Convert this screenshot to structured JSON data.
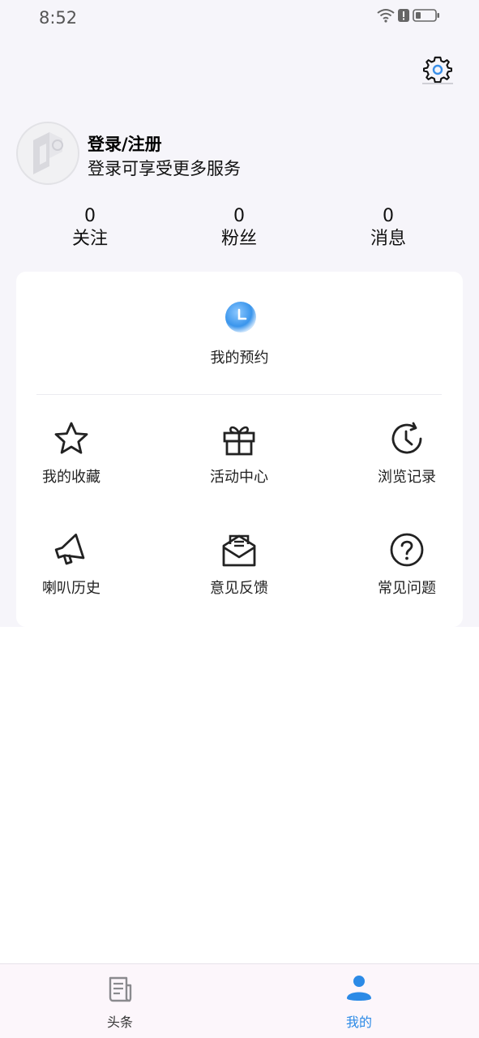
{
  "status_bar": {
    "time": "8:52"
  },
  "profile": {
    "title": "登录/注册",
    "subtitle": "登录可享受更多服务"
  },
  "stats": [
    {
      "value": "0",
      "label": "关注"
    },
    {
      "value": "0",
      "label": "粉丝"
    },
    {
      "value": "0",
      "label": "消息"
    }
  ],
  "appointment": {
    "label": "我的预约"
  },
  "grid": [
    {
      "label": "我的收藏",
      "icon": "star-icon"
    },
    {
      "label": "活动中心",
      "icon": "gift-icon"
    },
    {
      "label": "浏览记录",
      "icon": "history-clock-icon"
    },
    {
      "label": "喇叭历史",
      "icon": "megaphone-icon"
    },
    {
      "label": "意见反馈",
      "icon": "feedback-envelope-icon"
    },
    {
      "label": "常见问题",
      "icon": "question-icon"
    }
  ],
  "tabs": [
    {
      "label": "头条",
      "icon": "news-icon",
      "active": false
    },
    {
      "label": "我的",
      "icon": "person-icon",
      "active": true
    }
  ],
  "colors": {
    "accent": "#2b8ae6",
    "page_bg": "#f6f5fa",
    "tabbar_bg": "#fcf6fb",
    "inactive": "#888888"
  }
}
